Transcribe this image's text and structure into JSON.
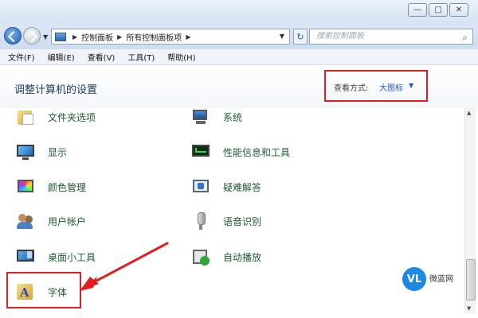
{
  "window": {
    "controls": [
      "—",
      "□",
      "✕"
    ]
  },
  "address_bar": {
    "crumbs": [
      "控制面板",
      "所有控制面板项"
    ],
    "search_placeholder": "搜索控制面板"
  },
  "menu": [
    "文件(F)",
    "编辑(E)",
    "查看(V)",
    "工具(T)",
    "帮助(H)"
  ],
  "header": {
    "title": "调整计算机的设置",
    "view_label": "查看方式:",
    "view_value": "大图标"
  },
  "items": {
    "folder_options": "文件夹选项",
    "system": "系统",
    "display": "显示",
    "performance": "性能信息和工具",
    "color_management": "颜色管理",
    "troubleshooting": "疑难解答",
    "user_accounts": "用户帐户",
    "speech": "语音识别",
    "gadgets": "桌面小工具",
    "autoplay": "自动播放",
    "fonts": "字体"
  },
  "watermark": {
    "logo": "VL",
    "name": "微蓝网"
  },
  "colors": {
    "highlight": "#e02020",
    "item_text": "#1f5a34",
    "link": "#1e5bb8"
  }
}
